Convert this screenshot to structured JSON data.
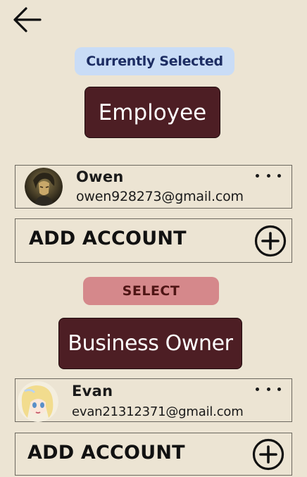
{
  "nav": {
    "back_icon": "arrow-left-icon"
  },
  "current_section": {
    "badge_label": "Currently Selected",
    "role_label": "Employee",
    "account": {
      "name": "Owen",
      "email": "owen928273@gmail.com",
      "menu_icon": "more-horizontal-icon"
    },
    "add_account_label": "ADD ACCOUNT",
    "add_icon": "plus-circle-icon"
  },
  "select_section": {
    "badge_label": "SELECT",
    "role_label": "Business Owner",
    "account": {
      "name": "Evan",
      "email": "evan21312371@gmail.com",
      "menu_icon": "more-horizontal-icon"
    },
    "add_account_label": "ADD ACCOUNT",
    "add_icon": "plus-circle-icon"
  },
  "colors": {
    "background": "#ECE4D3",
    "role_button": "#4D1E24",
    "current_badge": "#C9DCF6",
    "select_badge": "#D5888B"
  }
}
